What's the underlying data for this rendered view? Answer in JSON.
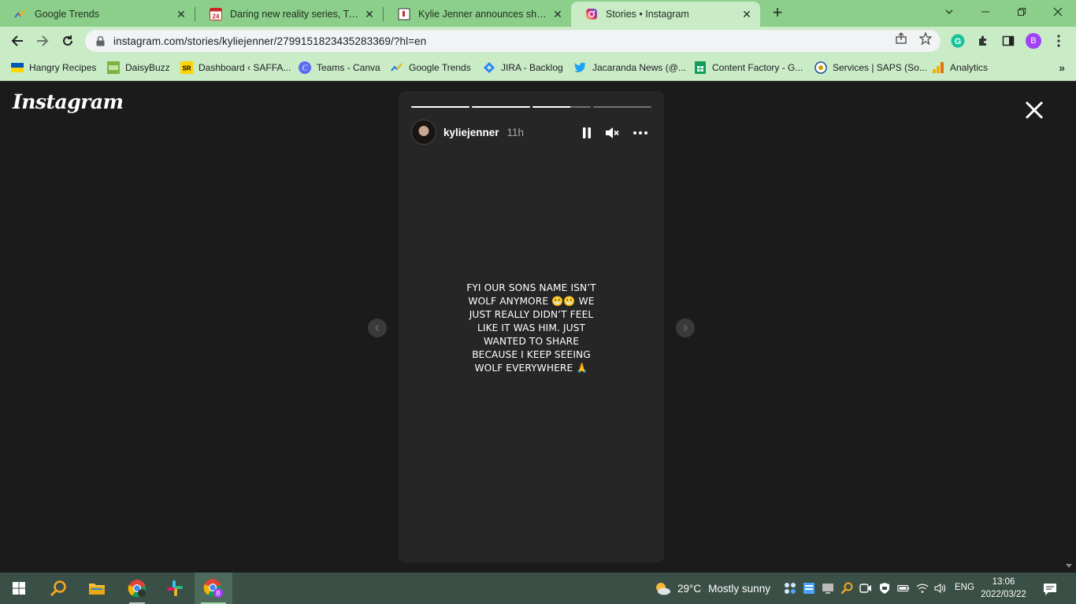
{
  "browser": {
    "tabs": [
      {
        "title": "Google Trends",
        "icon": "google-trends-icon",
        "active": false
      },
      {
        "title": "Daring new reality series, Twice a...",
        "icon": "news24-icon",
        "active": false
      },
      {
        "title": "Kylie Jenner announces she's cha...",
        "icon": "page-icon",
        "active": false
      },
      {
        "title": "Stories • Instagram",
        "icon": "instagram-icon",
        "active": true
      }
    ],
    "new_tab_label": "+",
    "url": "instagram.com/stories/kyliejenner/2799151823435283369/?hl=en",
    "profile_initial": "B",
    "bookmarks": [
      {
        "label": "Hangry Recipes",
        "icon": "flag-icon"
      },
      {
        "label": "DaisyBuzz",
        "icon": "daisybuzz-icon"
      },
      {
        "label": "Dashboard ‹ SAFFA...",
        "icon": "sr-icon"
      },
      {
        "label": "Teams - Canva",
        "icon": "canva-icon"
      },
      {
        "label": "Google Trends",
        "icon": "google-trends-icon"
      },
      {
        "label": "JIRA - Backlog",
        "icon": "jira-icon"
      },
      {
        "label": "Jacaranda News (@...",
        "icon": "twitter-icon"
      },
      {
        "label": "Content Factory - G...",
        "icon": "sheets-icon"
      },
      {
        "label": "Services | SAPS (So...",
        "icon": "saps-icon"
      },
      {
        "label": "Analytics",
        "icon": "analytics-icon"
      }
    ],
    "bookmarks_more": "»"
  },
  "instagram": {
    "logo": "Instagram",
    "story": {
      "username": "kyliejenner",
      "time": "11h",
      "progress": [
        1,
        1,
        0.65,
        0
      ],
      "text_lines": [
        "FYI OUR SONS NAME ISN’T",
        "WOLF ANYMORE 😬😬 WE",
        "JUST REALLY DIDN’T FEEL",
        "LIKE IT WAS HIM. JUST",
        "WANTED TO SHARE",
        "BECAUSE I KEEP SEEING",
        "WOLF EVERYWHERE 🙏"
      ]
    }
  },
  "taskbar": {
    "weather_temp": "29°C",
    "weather_text": "Mostly sunny",
    "language": "ENG",
    "time": "13:06",
    "date": "2022/03/22"
  },
  "colors": {
    "tabstrip": "#8ccf8b",
    "toolbar": "#c9ebc6",
    "viewport_bg": "#1b1b1b",
    "story_bg": "#262626",
    "taskbar": "#3a4f45"
  }
}
